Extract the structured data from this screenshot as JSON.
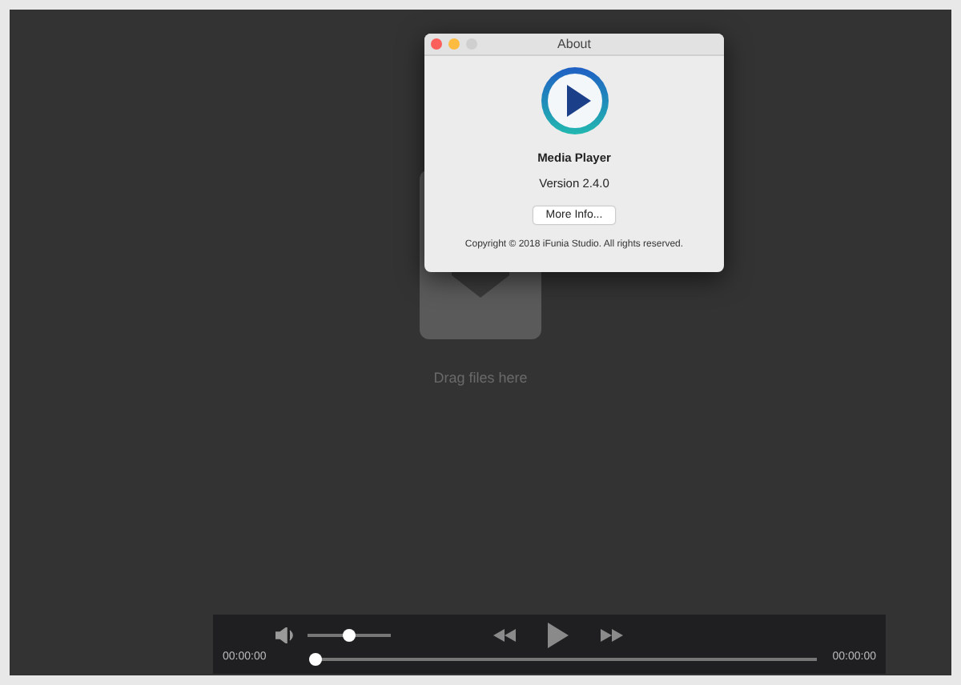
{
  "drop_area": {
    "label": "Drag files here"
  },
  "about_dialog": {
    "title": "About",
    "app_name": "Media Player",
    "version": "Version 2.4.0",
    "button": "More Info...",
    "copyright": "Copyright © 2018 iFunia Studio. All rights reserved."
  },
  "controls": {
    "volume": {
      "level": 0.5
    },
    "elapsed": "00:00:00",
    "progress": {
      "level": 0
    },
    "duration": "00:00:00"
  }
}
